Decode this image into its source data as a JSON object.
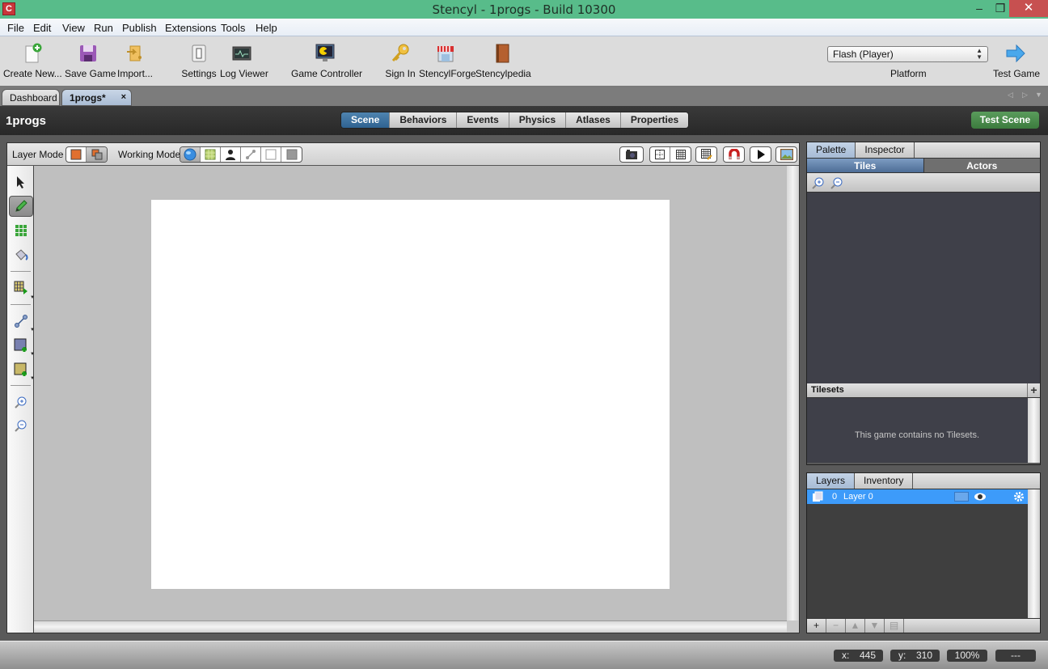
{
  "window": {
    "title": "Stencyl - 1progs - Build 10300",
    "app_icon_letter": "C",
    "controls": {
      "minimize": "–",
      "maximize": "❒",
      "close": "✕"
    }
  },
  "menu": [
    "File",
    "Edit",
    "View",
    "Run",
    "Publish",
    "Extensions",
    "Tools",
    "Help"
  ],
  "toolbar": {
    "buttons": [
      {
        "label": "Create New...",
        "icon": "create-new-icon"
      },
      {
        "label": "Save Game",
        "icon": "save-icon"
      },
      {
        "label": "Import...",
        "icon": "import-icon"
      },
      {
        "label": "Settings",
        "icon": "settings-switch-icon"
      },
      {
        "label": "Log Viewer",
        "icon": "log-viewer-icon"
      },
      {
        "label": "Game Controller",
        "icon": "game-controller-icon"
      },
      {
        "label": "Sign In",
        "icon": "key-icon"
      },
      {
        "label": "StencylForge",
        "icon": "store-icon"
      },
      {
        "label": "Stencylpedia",
        "icon": "book-icon"
      }
    ],
    "platform": {
      "selected": "Flash (Player)",
      "label": "Platform"
    },
    "test_game": "Test Game"
  },
  "doc_tabs": [
    {
      "label": "Dashboard",
      "active": false
    },
    {
      "label": "1progs*",
      "active": true,
      "close": "×"
    }
  ],
  "scene": {
    "title": "1progs",
    "tabs": [
      {
        "label": "Scene",
        "active": true
      },
      {
        "label": "Behaviors",
        "active": false
      },
      {
        "label": "Events",
        "active": false
      },
      {
        "label": "Physics",
        "active": false
      },
      {
        "label": "Atlases",
        "active": false
      },
      {
        "label": "Properties",
        "active": false
      }
    ],
    "test_scene": "Test Scene"
  },
  "editor": {
    "layer_mode_label": "Layer Mode",
    "working_mode_label": "Working Mode",
    "side_tools": [
      "select",
      "pencil",
      "tile-grid",
      "bucket-fill",
      "tile-stamp",
      "line",
      "region",
      "terrain",
      "zoom-in",
      "zoom-out"
    ]
  },
  "palette": {
    "tabs": [
      {
        "label": "Palette",
        "active": true
      },
      {
        "label": "Inspector",
        "active": false
      }
    ],
    "subtabs": [
      {
        "label": "Tiles",
        "active": true
      },
      {
        "label": "Actors",
        "active": false
      }
    ],
    "tilesets_header": "Tilesets",
    "tilesets_empty": "This game contains no Tilesets."
  },
  "layers": {
    "tabs": [
      {
        "label": "Layers",
        "active": true
      },
      {
        "label": "Inventory",
        "active": false
      }
    ],
    "rows": [
      {
        "index": "0",
        "name": "Layer 0",
        "visible": true
      }
    ]
  },
  "status": {
    "x_label": "x:",
    "x": "445",
    "y_label": "y:",
    "y": "310",
    "zoom": "100%",
    "extra": "---"
  },
  "colors": {
    "titlebar": "#58bc8a",
    "active_tab": "#2f6290",
    "test_scene": "#3c7b3e",
    "layer_selected": "#3d9bfa"
  }
}
